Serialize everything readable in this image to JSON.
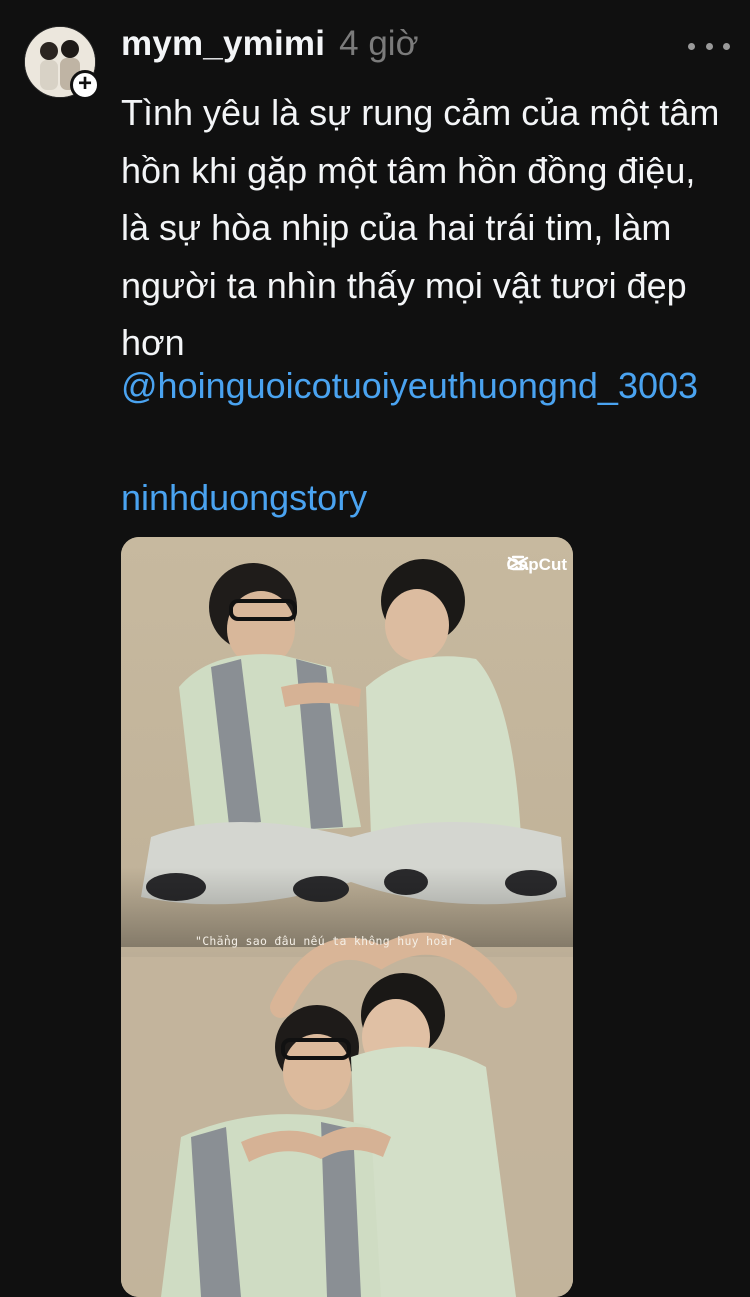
{
  "post": {
    "username": "mym_ymimi",
    "timestamp": "4 giờ",
    "caption": "Tình yêu là sự rung cảm của một tâm hồn khi gặp một tâm hồn đồng điệu, là sự hòa nhịp của hai trái tim, làm người ta nhìn thấy mọi vật tươi đẹp hơn",
    "mention": "@hoinguoicotuoiyeuthuongnd_3003",
    "hashtag": "ninhduongstory",
    "follow_icon": "plus-icon",
    "more_icon": "more-horizontal-icon"
  },
  "media": {
    "watermark": "CapCut",
    "overlay_text": "\"Chẳng sao đâu nếu ta không huy hoàr",
    "colors": {
      "backdrop": "#c9bca4",
      "shirt": "#cfdcc3",
      "stripe": "#8a8f94",
      "pants": "#d4d6d0"
    }
  },
  "colors": {
    "background": "#101010",
    "text": "#f3f5f7",
    "muted": "#7b7b7b",
    "link": "#4aa3f0"
  }
}
